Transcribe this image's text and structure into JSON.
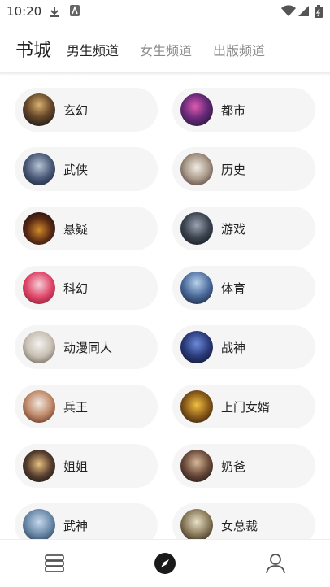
{
  "status": {
    "time": "10:20"
  },
  "header": {
    "title": "书城",
    "tabs": [
      {
        "label": "男生频道"
      },
      {
        "label": "女生频道"
      },
      {
        "label": "出版频道"
      }
    ]
  },
  "categories": [
    {
      "label": "玄幻"
    },
    {
      "label": "都市"
    },
    {
      "label": "武侠"
    },
    {
      "label": "历史"
    },
    {
      "label": "悬疑"
    },
    {
      "label": "游戏"
    },
    {
      "label": "科幻"
    },
    {
      "label": "体育"
    },
    {
      "label": "动漫同人"
    },
    {
      "label": "战神"
    },
    {
      "label": "兵王"
    },
    {
      "label": "上门女婿"
    },
    {
      "label": "姐姐"
    },
    {
      "label": "奶爸"
    },
    {
      "label": "武神"
    },
    {
      "label": "女总裁"
    }
  ],
  "nav": {
    "items": [
      {
        "icon": "bookshelf-icon"
      },
      {
        "icon": "discover-compass-icon"
      },
      {
        "icon": "profile-icon"
      }
    ]
  }
}
